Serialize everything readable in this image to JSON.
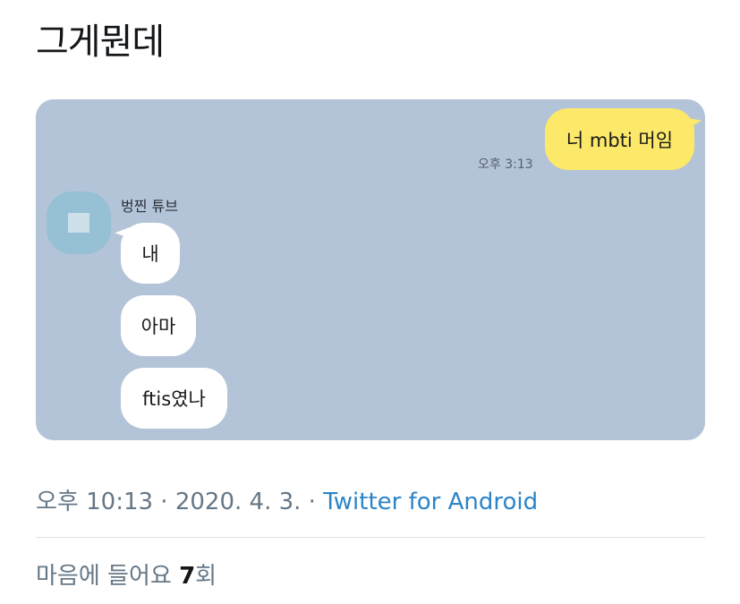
{
  "tweet": {
    "text": "그게뭔데"
  },
  "chat": {
    "outgoing": {
      "text": "너 mbti 머임",
      "time": "오후 3:13"
    },
    "sender_name": "벙찐 튜브",
    "incoming": [
      "내",
      "아마",
      "ftis였나"
    ],
    "colors": {
      "background": "#b4c4d8",
      "outgoing_bubble": "#fce869",
      "incoming_bubble": "#ffffff",
      "avatar": "#96c0d3"
    }
  },
  "meta": {
    "time": "오후 10:13",
    "sep1": " · ",
    "date": "2020. 4. 3.",
    "sep2": " · ",
    "source": "Twitter for Android"
  },
  "likes": {
    "label": "마음에 들어요 ",
    "count": "7",
    "unit": "회"
  }
}
